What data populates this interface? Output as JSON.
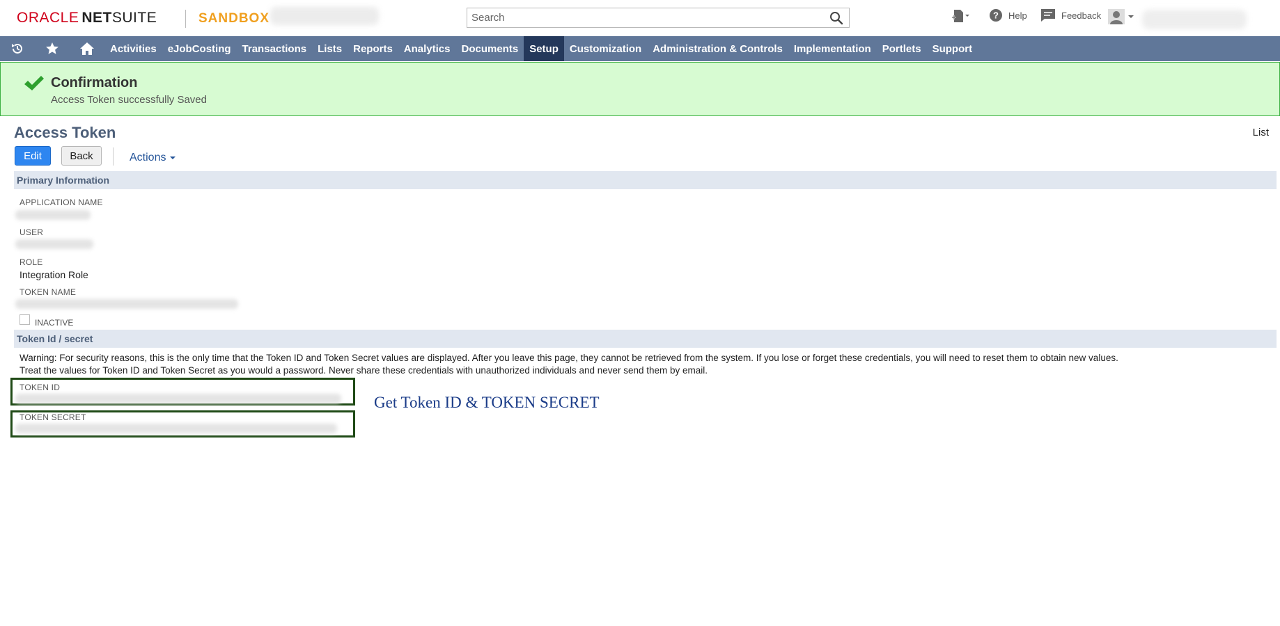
{
  "header": {
    "logo_oracle": "ORACLE",
    "logo_net": "NET",
    "logo_suite": "SUITE",
    "sandbox": "SANDBOX",
    "search_placeholder": "Search",
    "help_label": "Help",
    "feedback_label": "Feedback"
  },
  "nav": {
    "items": [
      "Activities",
      "eJobCosting",
      "Transactions",
      "Lists",
      "Reports",
      "Analytics",
      "Documents",
      "Setup",
      "Customization",
      "Administration & Controls",
      "Implementation",
      "Portlets",
      "Support"
    ],
    "active": "Setup"
  },
  "confirmation": {
    "title": "Confirmation",
    "message": "Access Token successfully Saved"
  },
  "page": {
    "title": "Access Token",
    "list_link": "List",
    "edit_button": "Edit",
    "back_button": "Back",
    "actions_label": "Actions"
  },
  "primary": {
    "section_title": "Primary Information",
    "application_name_label": "APPLICATION NAME",
    "user_label": "USER",
    "role_label": "ROLE",
    "role_value": "Integration Role",
    "token_name_label": "TOKEN NAME",
    "inactive_label": "INACTIVE"
  },
  "token": {
    "section_title": "Token Id / secret",
    "warning_line1": "Warning: For security reasons, this is the only time that the Token ID and Token Secret values are displayed. After you leave this page, they cannot be retrieved from the system. If you lose or forget these credentials, you will need to reset them to obtain new values.",
    "warning_line2": "Treat the values for Token ID and Token Secret as you would a password. Never share these credentials with unauthorized individuals and never send them by email.",
    "token_id_label": "TOKEN ID",
    "token_secret_label": "TOKEN SECRET"
  },
  "annotation": "Get Token ID & TOKEN SECRET",
  "colors": {
    "nav_bg": "#607799",
    "nav_active": "#24385b",
    "confirm_bg": "#d7fbd2",
    "edit_button": "#2e86f0",
    "highlight_border": "#1f4a16",
    "annotation_text": "#1b3c88"
  }
}
